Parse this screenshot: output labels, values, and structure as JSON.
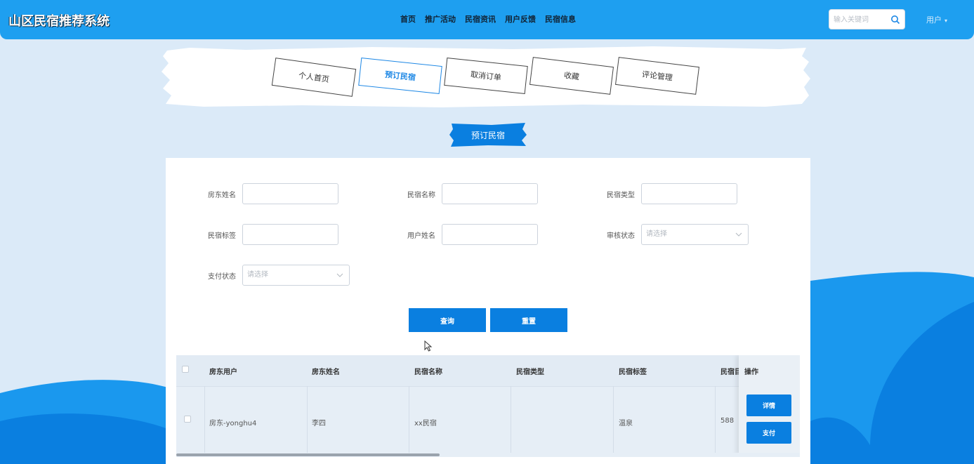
{
  "app": {
    "title": "山区民宿推荐系统"
  },
  "nav": {
    "items": [
      "首页",
      "推广活动",
      "民宿资讯",
      "用户反馈",
      "民宿信息"
    ]
  },
  "search": {
    "placeholder": "输入关键词"
  },
  "user_menu": {
    "label": "用户"
  },
  "tabs": [
    {
      "label": "个人首页",
      "active": false
    },
    {
      "label": "预订民宿",
      "active": true
    },
    {
      "label": "取消订单",
      "active": false
    },
    {
      "label": "收藏",
      "active": false
    },
    {
      "label": "评论管理",
      "active": false
    }
  ],
  "section_title": "预订民宿",
  "form": {
    "landlord_name_label": "房东姓名",
    "homestay_name_label": "民宿名称",
    "homestay_type_label": "民宿类型",
    "homestay_tag_label": "民宿标签",
    "user_name_label": "用户姓名",
    "review_status_label": "审核状态",
    "review_status_placeholder": "请选择",
    "pay_status_label": "支付状态",
    "pay_status_placeholder": "请选择",
    "query_button": "查询",
    "reset_button": "重置"
  },
  "table": {
    "columns": [
      "房东用户",
      "房东姓名",
      "民宿名称",
      "民宿类型",
      "民宿标签",
      "民宿目",
      "操作"
    ],
    "rows": [
      {
        "landlord_user": "房东-yonghu4",
        "landlord_name": "李四",
        "homestay_name": "xx民宿",
        "homestay_type": "",
        "homestay_tag": "温泉",
        "price": "588",
        "actions": [
          "详情",
          "支付"
        ]
      }
    ]
  },
  "colors": {
    "header": "#1e9ff0",
    "primary_button": "#0a7fe0",
    "background": "#dbeaf8"
  }
}
